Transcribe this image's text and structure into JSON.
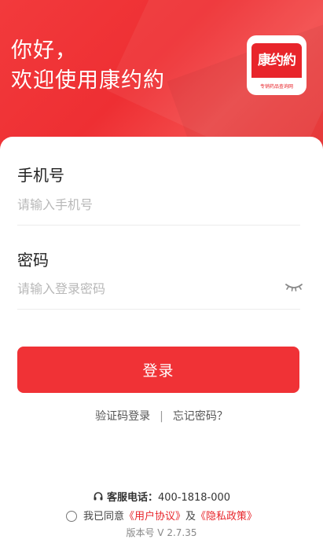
{
  "header": {
    "greeting_line1": "你好，",
    "greeting_line2": "欢迎使用康约約",
    "logo_brand": "康约約",
    "logo_tagline": "专销药品查询网"
  },
  "form": {
    "phone_label": "手机号",
    "phone_placeholder": "请输入手机号",
    "password_label": "密码",
    "password_placeholder": "请输入登录密码"
  },
  "actions": {
    "login_label": "登录",
    "sms_login": "验证码登录",
    "separator": "|",
    "forgot_password": "忘记密码？"
  },
  "footer": {
    "service_label": "客服电话：",
    "service_phone": "400-1818-000",
    "agree_prefix": "我已同意",
    "user_agreement": "《用户协议》",
    "and": "及",
    "privacy_policy": "《隐私政策》",
    "version": "版本号 V 2.7.35"
  },
  "colors": {
    "brand": "#f03236",
    "header_bg": "#ee2f33"
  },
  "icons": {
    "password_toggle": "eye-closed-icon",
    "service": "headset-icon",
    "agree": "radio-unchecked-icon"
  }
}
